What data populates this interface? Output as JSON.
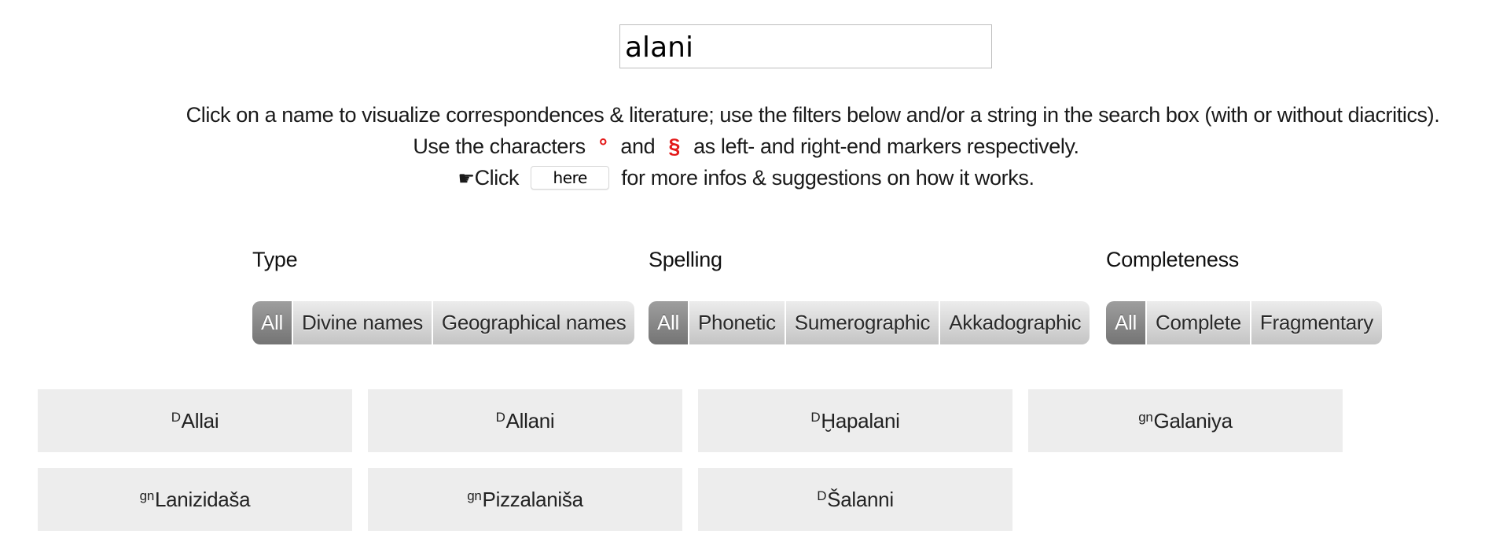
{
  "search": {
    "value": "alani"
  },
  "intro": {
    "line1": "Click on a name to visualize correspondences & literature; use the filters below and/or a string in the search box (with or without diacritics).",
    "line2_before": "Use the characters",
    "left_marker": "°",
    "line2_and": "and",
    "right_marker": "§",
    "line2_after": "as left- and right-end markers respectively.",
    "hand_icon": "☛",
    "line3_before": "Click",
    "help_button_label": "here",
    "line3_after": "for more infos & suggestions on how it works."
  },
  "colors": {
    "marker": "#e31a1a",
    "card_background": "#ededed",
    "active_filter": "#8a8a8a"
  },
  "filters": {
    "type": {
      "title": "Type",
      "selected": "All",
      "options": [
        "All",
        "Divine names",
        "Geographical names"
      ]
    },
    "spelling": {
      "title": "Spelling",
      "selected": "All",
      "options": [
        "All",
        "Phonetic",
        "Sumerographic",
        "Akkadographic"
      ]
    },
    "completeness": {
      "title": "Completeness",
      "selected": "All",
      "options": [
        "All",
        "Complete",
        "Fragmentary"
      ]
    }
  },
  "results": [
    {
      "determinative": "D",
      "name": "Allai"
    },
    {
      "determinative": "D",
      "name": "Allani"
    },
    {
      "determinative": "D",
      "name": "Ḫapalani"
    },
    {
      "determinative": "gn",
      "name": "Galaniya"
    },
    {
      "determinative": "gn",
      "name": "Lanizidaša"
    },
    {
      "determinative": "gn",
      "name": "Pizzalaniša"
    },
    {
      "determinative": "D",
      "name": "Šalanni"
    }
  ]
}
